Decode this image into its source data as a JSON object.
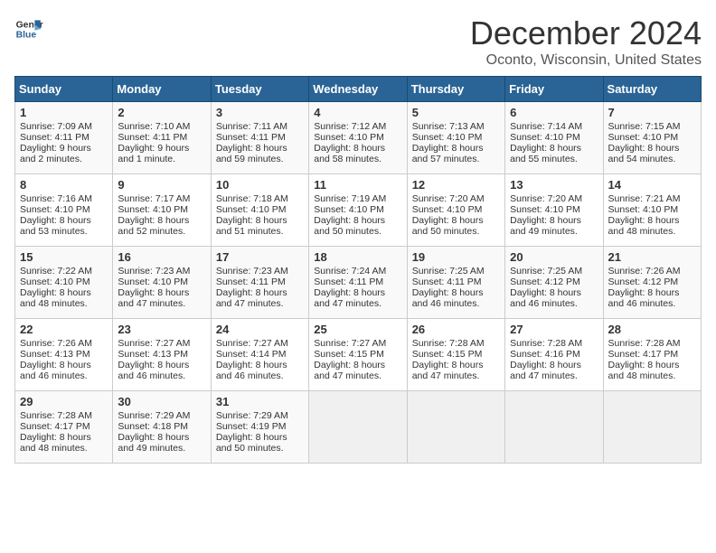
{
  "logo": {
    "line1": "General",
    "line2": "Blue"
  },
  "title": "December 2024",
  "location": "Oconto, Wisconsin, United States",
  "days_of_week": [
    "Sunday",
    "Monday",
    "Tuesday",
    "Wednesday",
    "Thursday",
    "Friday",
    "Saturday"
  ],
  "weeks": [
    [
      {
        "day": "1",
        "sunrise": "Sunrise: 7:09 AM",
        "sunset": "Sunset: 4:11 PM",
        "daylight": "Daylight: 9 hours and 2 minutes."
      },
      {
        "day": "2",
        "sunrise": "Sunrise: 7:10 AM",
        "sunset": "Sunset: 4:11 PM",
        "daylight": "Daylight: 9 hours and 1 minute."
      },
      {
        "day": "3",
        "sunrise": "Sunrise: 7:11 AM",
        "sunset": "Sunset: 4:11 PM",
        "daylight": "Daylight: 8 hours and 59 minutes."
      },
      {
        "day": "4",
        "sunrise": "Sunrise: 7:12 AM",
        "sunset": "Sunset: 4:10 PM",
        "daylight": "Daylight: 8 hours and 58 minutes."
      },
      {
        "day": "5",
        "sunrise": "Sunrise: 7:13 AM",
        "sunset": "Sunset: 4:10 PM",
        "daylight": "Daylight: 8 hours and 57 minutes."
      },
      {
        "day": "6",
        "sunrise": "Sunrise: 7:14 AM",
        "sunset": "Sunset: 4:10 PM",
        "daylight": "Daylight: 8 hours and 55 minutes."
      },
      {
        "day": "7",
        "sunrise": "Sunrise: 7:15 AM",
        "sunset": "Sunset: 4:10 PM",
        "daylight": "Daylight: 8 hours and 54 minutes."
      }
    ],
    [
      {
        "day": "8",
        "sunrise": "Sunrise: 7:16 AM",
        "sunset": "Sunset: 4:10 PM",
        "daylight": "Daylight: 8 hours and 53 minutes."
      },
      {
        "day": "9",
        "sunrise": "Sunrise: 7:17 AM",
        "sunset": "Sunset: 4:10 PM",
        "daylight": "Daylight: 8 hours and 52 minutes."
      },
      {
        "day": "10",
        "sunrise": "Sunrise: 7:18 AM",
        "sunset": "Sunset: 4:10 PM",
        "daylight": "Daylight: 8 hours and 51 minutes."
      },
      {
        "day": "11",
        "sunrise": "Sunrise: 7:19 AM",
        "sunset": "Sunset: 4:10 PM",
        "daylight": "Daylight: 8 hours and 50 minutes."
      },
      {
        "day": "12",
        "sunrise": "Sunrise: 7:20 AM",
        "sunset": "Sunset: 4:10 PM",
        "daylight": "Daylight: 8 hours and 50 minutes."
      },
      {
        "day": "13",
        "sunrise": "Sunrise: 7:20 AM",
        "sunset": "Sunset: 4:10 PM",
        "daylight": "Daylight: 8 hours and 49 minutes."
      },
      {
        "day": "14",
        "sunrise": "Sunrise: 7:21 AM",
        "sunset": "Sunset: 4:10 PM",
        "daylight": "Daylight: 8 hours and 48 minutes."
      }
    ],
    [
      {
        "day": "15",
        "sunrise": "Sunrise: 7:22 AM",
        "sunset": "Sunset: 4:10 PM",
        "daylight": "Daylight: 8 hours and 48 minutes."
      },
      {
        "day": "16",
        "sunrise": "Sunrise: 7:23 AM",
        "sunset": "Sunset: 4:10 PM",
        "daylight": "Daylight: 8 hours and 47 minutes."
      },
      {
        "day": "17",
        "sunrise": "Sunrise: 7:23 AM",
        "sunset": "Sunset: 4:11 PM",
        "daylight": "Daylight: 8 hours and 47 minutes."
      },
      {
        "day": "18",
        "sunrise": "Sunrise: 7:24 AM",
        "sunset": "Sunset: 4:11 PM",
        "daylight": "Daylight: 8 hours and 47 minutes."
      },
      {
        "day": "19",
        "sunrise": "Sunrise: 7:25 AM",
        "sunset": "Sunset: 4:11 PM",
        "daylight": "Daylight: 8 hours and 46 minutes."
      },
      {
        "day": "20",
        "sunrise": "Sunrise: 7:25 AM",
        "sunset": "Sunset: 4:12 PM",
        "daylight": "Daylight: 8 hours and 46 minutes."
      },
      {
        "day": "21",
        "sunrise": "Sunrise: 7:26 AM",
        "sunset": "Sunset: 4:12 PM",
        "daylight": "Daylight: 8 hours and 46 minutes."
      }
    ],
    [
      {
        "day": "22",
        "sunrise": "Sunrise: 7:26 AM",
        "sunset": "Sunset: 4:13 PM",
        "daylight": "Daylight: 8 hours and 46 minutes."
      },
      {
        "day": "23",
        "sunrise": "Sunrise: 7:27 AM",
        "sunset": "Sunset: 4:13 PM",
        "daylight": "Daylight: 8 hours and 46 minutes."
      },
      {
        "day": "24",
        "sunrise": "Sunrise: 7:27 AM",
        "sunset": "Sunset: 4:14 PM",
        "daylight": "Daylight: 8 hours and 46 minutes."
      },
      {
        "day": "25",
        "sunrise": "Sunrise: 7:27 AM",
        "sunset": "Sunset: 4:15 PM",
        "daylight": "Daylight: 8 hours and 47 minutes."
      },
      {
        "day": "26",
        "sunrise": "Sunrise: 7:28 AM",
        "sunset": "Sunset: 4:15 PM",
        "daylight": "Daylight: 8 hours and 47 minutes."
      },
      {
        "day": "27",
        "sunrise": "Sunrise: 7:28 AM",
        "sunset": "Sunset: 4:16 PM",
        "daylight": "Daylight: 8 hours and 47 minutes."
      },
      {
        "day": "28",
        "sunrise": "Sunrise: 7:28 AM",
        "sunset": "Sunset: 4:17 PM",
        "daylight": "Daylight: 8 hours and 48 minutes."
      }
    ],
    [
      {
        "day": "29",
        "sunrise": "Sunrise: 7:28 AM",
        "sunset": "Sunset: 4:17 PM",
        "daylight": "Daylight: 8 hours and 48 minutes."
      },
      {
        "day": "30",
        "sunrise": "Sunrise: 7:29 AM",
        "sunset": "Sunset: 4:18 PM",
        "daylight": "Daylight: 8 hours and 49 minutes."
      },
      {
        "day": "31",
        "sunrise": "Sunrise: 7:29 AM",
        "sunset": "Sunset: 4:19 PM",
        "daylight": "Daylight: 8 hours and 50 minutes."
      },
      null,
      null,
      null,
      null
    ]
  ]
}
